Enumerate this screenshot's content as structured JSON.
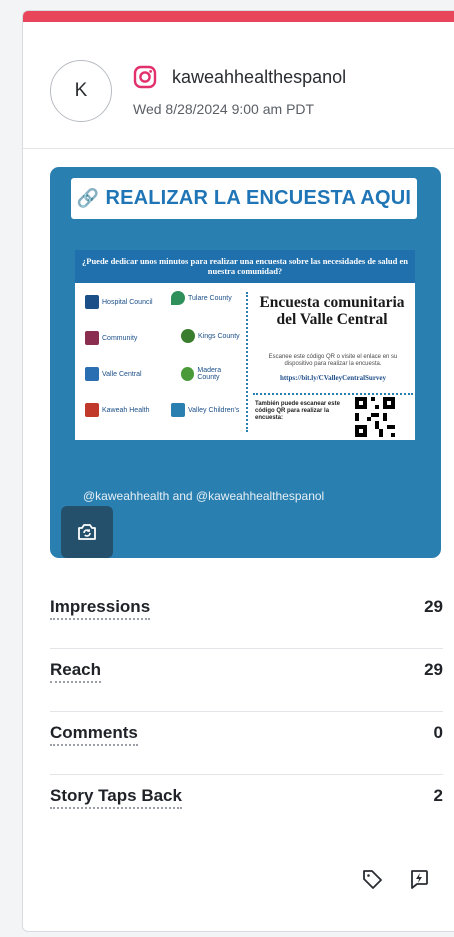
{
  "post": {
    "avatar_letter": "K",
    "platform_icon": "instagram-icon",
    "account": "kaweahhealthespanol",
    "datetime": "Wed 8/28/2024 9:00 am PDT"
  },
  "story": {
    "banner_text": "REALIZAR LA ENCUESTA AQUI",
    "question": "¿Puede dedicar unos minutos para realizar una encuesta sobre las necesidades de salud en nuestra comunidad?",
    "survey_title": "Encuesta comunitaria del Valle Central",
    "survey_sub": "Escanee este código QR o visite el enlace en su dispositivo para realizar la encuesta.",
    "survey_url": "https://bit.ly/CValleyCentralSurvey",
    "qr_text": "También puede escanear este código QR para realizar la encuesta:",
    "logos": [
      "Hospital Council",
      "Tulare County",
      "Community",
      "Kings County",
      "Valle Central",
      "Valley Children's",
      "Kaweah Health",
      "Madera County"
    ],
    "caption": "@kaweahhealth and @kaweahhealthespanol",
    "camera_icon": "camera-switch-icon"
  },
  "metrics": [
    {
      "label": "Impressions",
      "value": "29"
    },
    {
      "label": "Reach",
      "value": "29"
    },
    {
      "label": "Comments",
      "value": "0"
    },
    {
      "label": "Story Taps Back",
      "value": "2"
    }
  ],
  "footer": {
    "tag_icon": "tag-icon",
    "boost_icon": "boost-icon"
  },
  "colors": {
    "accent_bar": "#e8445a",
    "story_bg": "#2a7fb1",
    "instagram": "#e1306c"
  }
}
